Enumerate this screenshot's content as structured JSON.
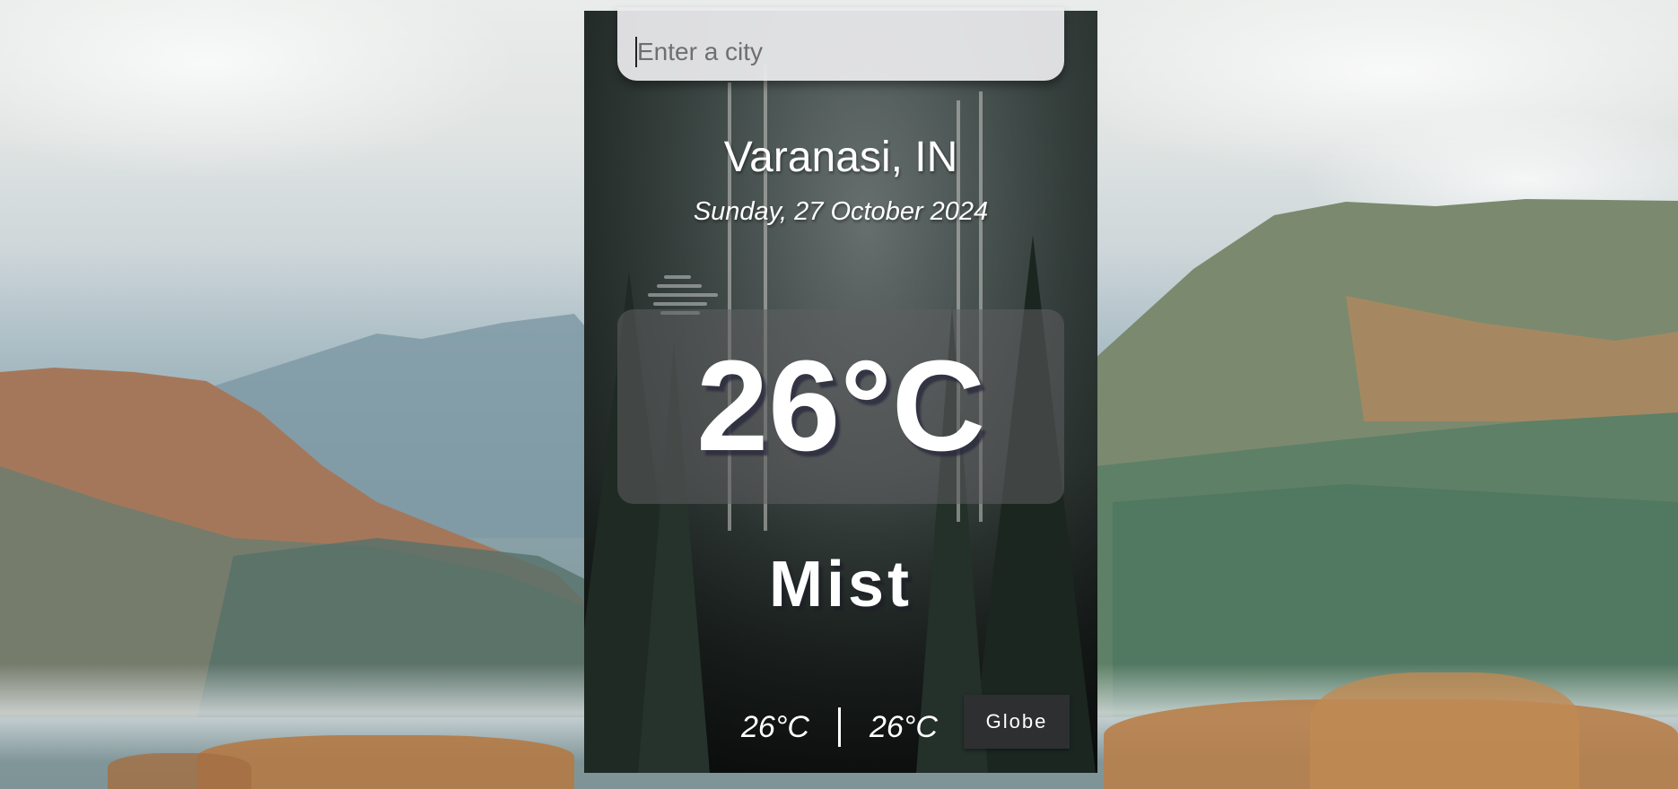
{
  "search": {
    "placeholder": "Enter a city"
  },
  "location": {
    "city": "Varanasi, IN",
    "date": "Sunday, 27 October 2024"
  },
  "weather": {
    "temperature": "26°C",
    "condition": "Mist",
    "condition_icon": "mist-icon",
    "low": "26°C",
    "high": "26°C"
  },
  "actions": {
    "globe_label": "Globe"
  },
  "colors": {
    "text": "#ffffff",
    "search_bg": "#ebebed",
    "temp_box_bg": "#5f5f61",
    "globe_button_bg": "#2e2f31"
  }
}
